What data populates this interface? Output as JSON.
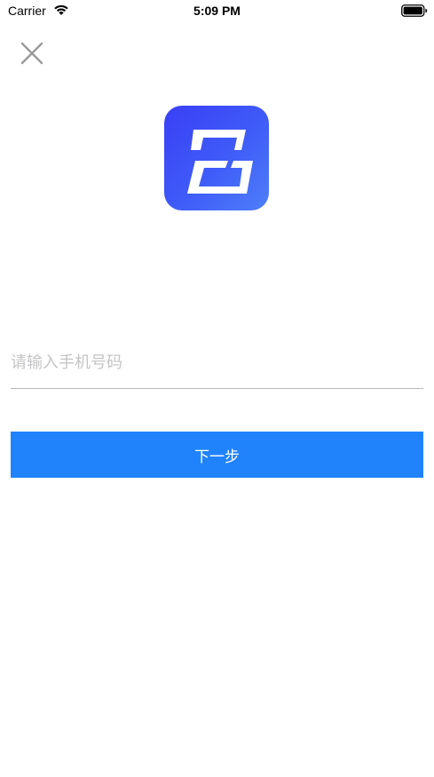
{
  "status_bar": {
    "carrier": "Carrier",
    "time": "5:09 PM"
  },
  "header": {
    "close_icon": "close-icon"
  },
  "logo": {
    "icon": "app-logo",
    "colors": {
      "gradient_start": "#3a3ff5",
      "gradient_end": "#4e7ff9"
    }
  },
  "form": {
    "phone_placeholder": "请输入手机号码",
    "phone_value": "",
    "next_label": "下一步"
  },
  "colors": {
    "primary": "#2183fb",
    "placeholder": "#c4c4c6",
    "divider": "#b7b7b7"
  }
}
